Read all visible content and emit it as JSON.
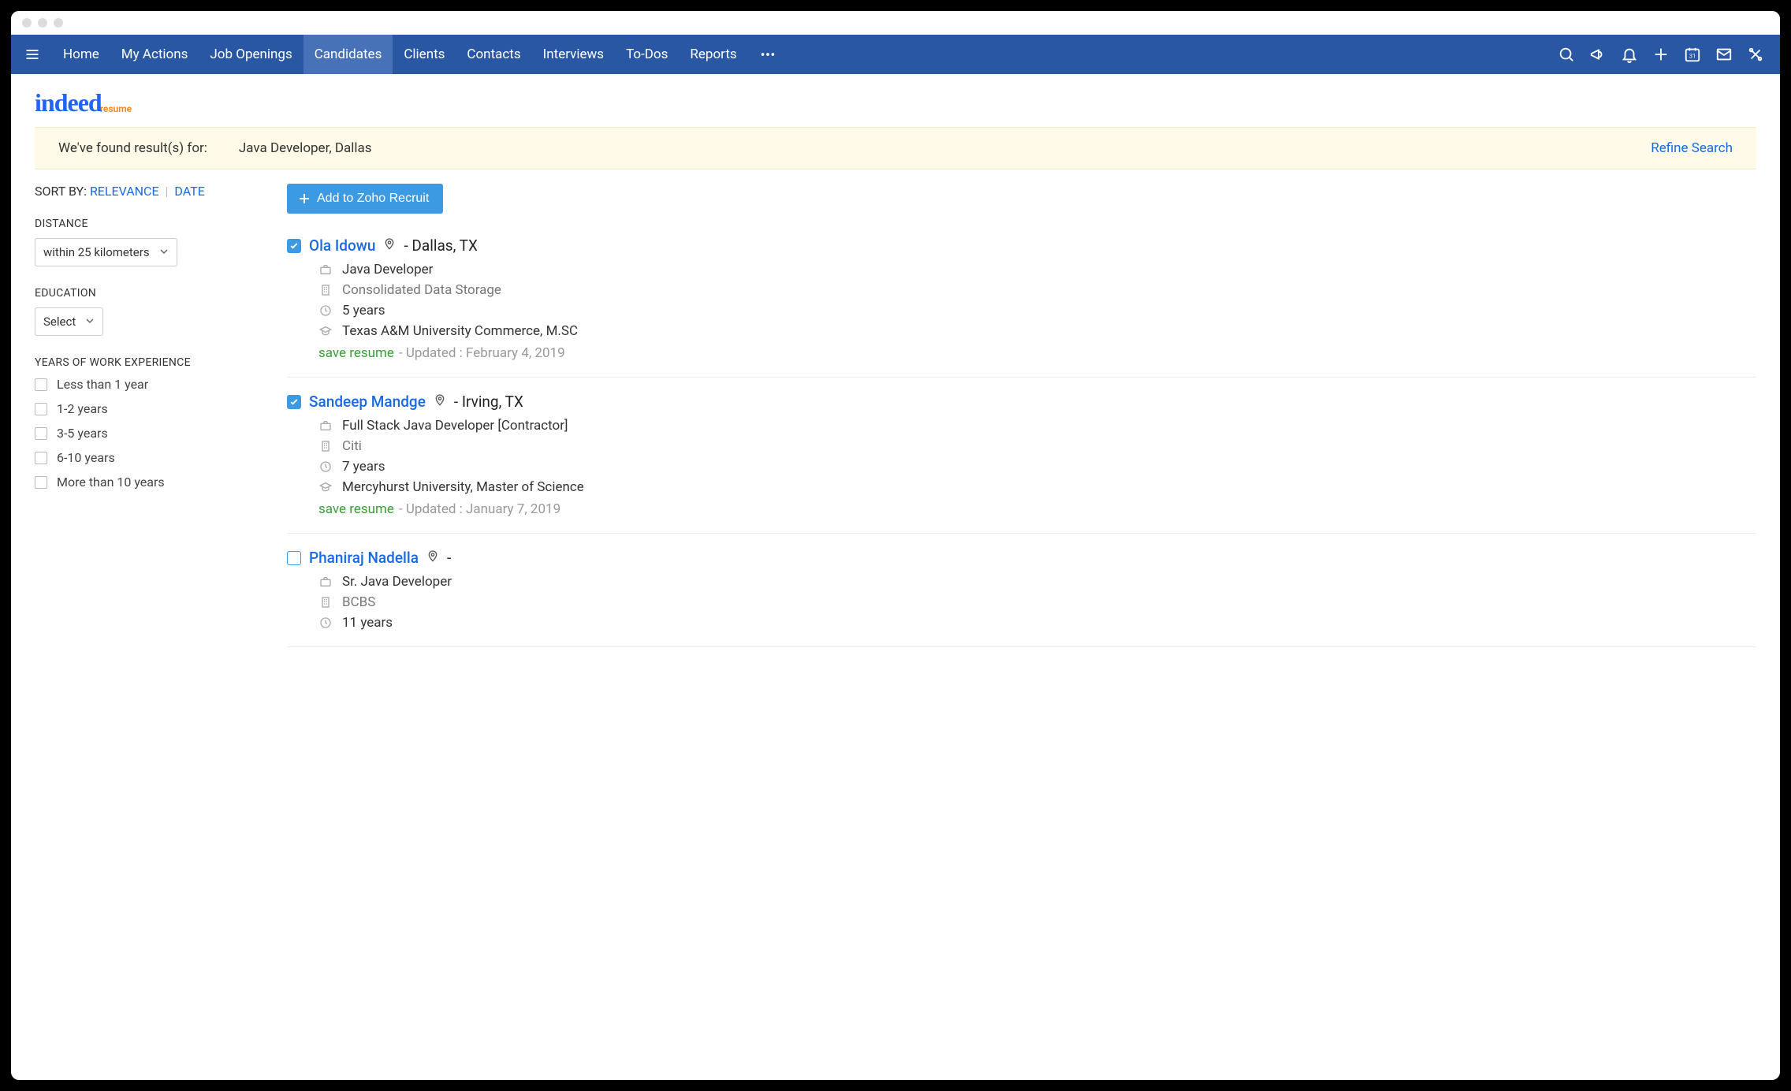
{
  "nav": {
    "items": [
      "Home",
      "My Actions",
      "Job Openings",
      "Candidates",
      "Clients",
      "Contacts",
      "Interviews",
      "To-Dos",
      "Reports"
    ],
    "active_index": 3
  },
  "logo": {
    "main": "indeed",
    "sub": "resume"
  },
  "results_bar": {
    "label": "We've found result(s) for:",
    "query": "Java Developer, Dallas",
    "refine": "Refine Search"
  },
  "sort": {
    "label": "SORT BY:",
    "relevance": "RELEVANCE",
    "date": "DATE"
  },
  "filters": {
    "distance": {
      "label": "DISTANCE",
      "value": "within 25 kilometers"
    },
    "education": {
      "label": "EDUCATION",
      "value": "Select"
    },
    "experience": {
      "label": "YEARS OF WORK EXPERIENCE",
      "options": [
        "Less than 1 year",
        "1-2 years",
        "3-5 years",
        "6-10 years",
        "More than 10 years"
      ]
    }
  },
  "add_button": "Add to Zoho Recruit",
  "save_resume_label": "save resume",
  "updated_prefix": "- Updated : ",
  "candidates": [
    {
      "checked": true,
      "name": "Ola Idowu",
      "location": "- Dallas, TX",
      "title": "Java Developer",
      "company": "Consolidated Data Storage",
      "experience": "5 years",
      "education": "Texas A&M University Commerce, M.SC",
      "updated": "February 4, 2019"
    },
    {
      "checked": true,
      "name": "Sandeep Mandge",
      "location": "- Irving, TX",
      "title": "Full Stack Java Developer [Contractor]",
      "company": "Citi",
      "experience": "7 years",
      "education": "Mercyhurst University, Master of Science",
      "updated": "January 7, 2019"
    },
    {
      "checked": false,
      "name": "Phaniraj Nadella",
      "location": "-",
      "title": "Sr. Java Developer",
      "company": "BCBS",
      "experience": "11 years",
      "education": "",
      "updated": ""
    }
  ]
}
